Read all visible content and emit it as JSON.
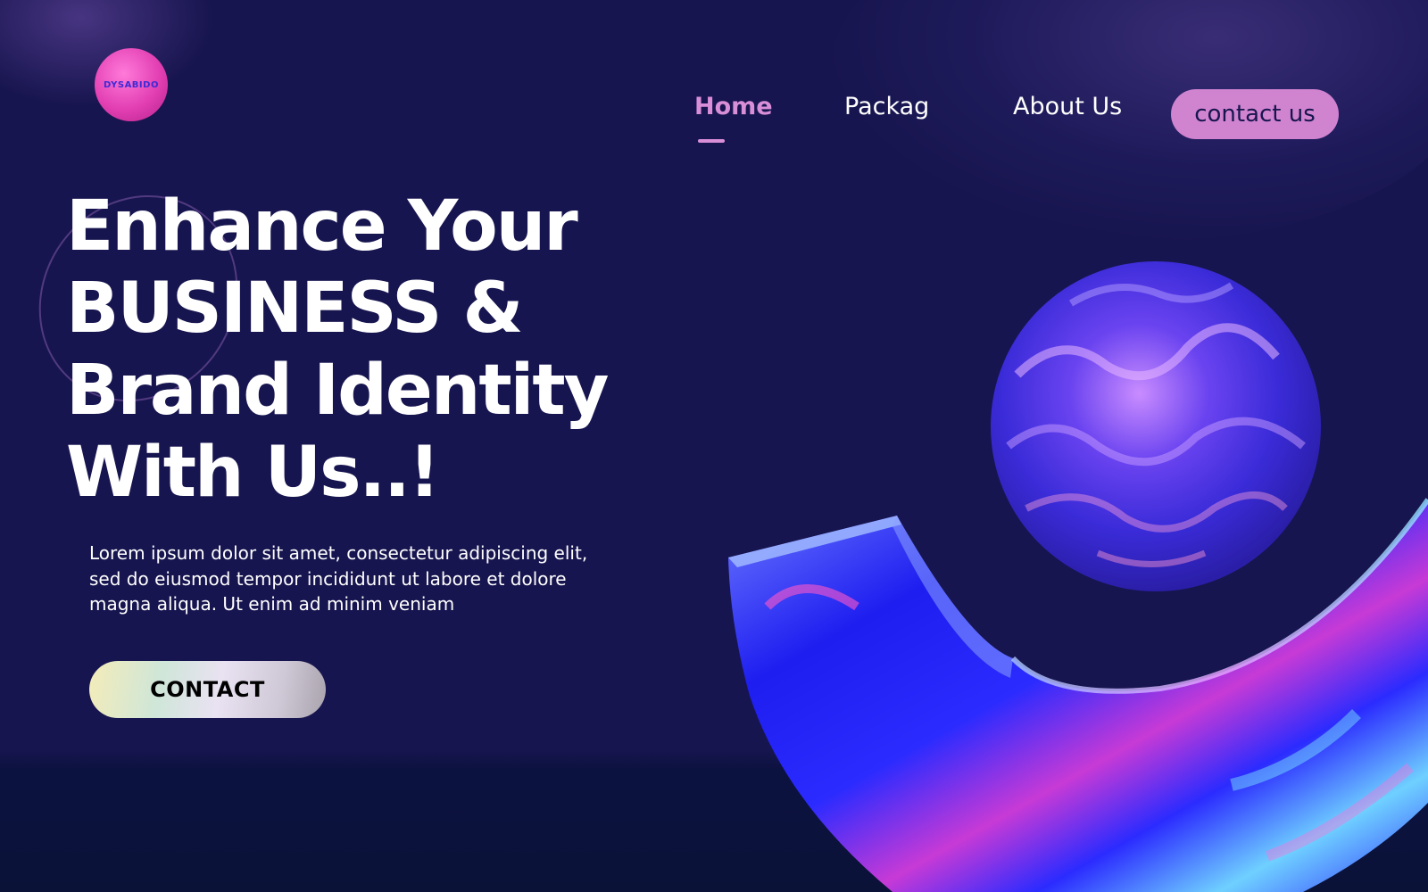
{
  "logo": {
    "text": "DYSABIDO"
  },
  "nav": {
    "items": [
      {
        "label": "Home",
        "active": true
      },
      {
        "label": "Packag",
        "active": false
      },
      {
        "label": "About Us",
        "active": false
      }
    ],
    "contact_button": "contact us"
  },
  "hero": {
    "title_lines": [
      "Enhance Your",
      "BUSINESS &",
      "Brand Identity",
      "With Us..!"
    ],
    "description_lines": [
      "Lorem ipsum dolor sit amet, consectetur adipiscing elit,",
      "sed do eiusmod tempor incididunt ut labore et dolore",
      "magna aliqua. Ut enim ad minim veniam"
    ],
    "cta_label": "CONTACT"
  },
  "colors": {
    "background": "#17154f",
    "accent_pink": "#d98ed8",
    "contact_button_bg": "#d083cf",
    "text": "#ffffff",
    "logo_pink": "#e23fb3",
    "art_blue": "#2d2df5"
  }
}
